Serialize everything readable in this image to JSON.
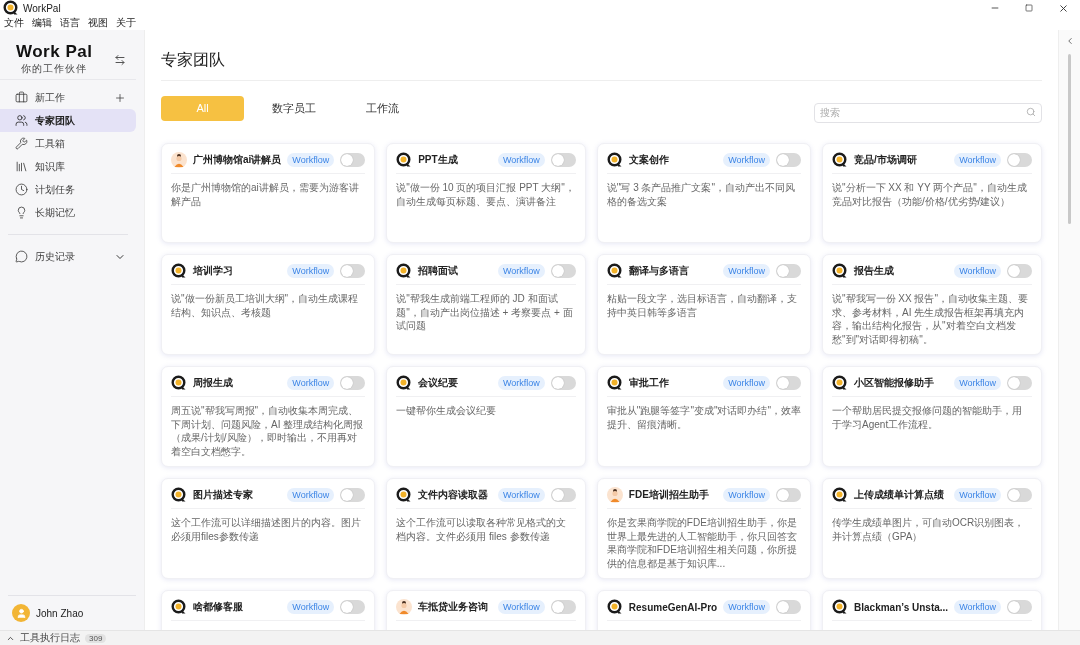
{
  "window": {
    "title": "WorkPal"
  },
  "menu": [
    "文件",
    "编辑",
    "语言",
    "视图",
    "关于"
  ],
  "sidebar": {
    "logo": "Work Pal",
    "tagline": "你的工作伙伴",
    "new_work": "新工作",
    "items": [
      {
        "label": "专家团队",
        "selected": true
      },
      {
        "label": "工具箱",
        "selected": false
      },
      {
        "label": "知识库",
        "selected": false
      },
      {
        "label": "计划任务",
        "selected": false
      },
      {
        "label": "长期记忆",
        "selected": false
      }
    ],
    "history": {
      "label": "历史记录",
      "expanded": false
    },
    "user": "John Zhao"
  },
  "page_title": "专家团队",
  "tabs": [
    {
      "label": "All",
      "selected": true
    },
    {
      "label": "数字员工",
      "selected": false
    },
    {
      "label": "工作流",
      "selected": false
    }
  ],
  "search": {
    "placeholder": "搜索"
  },
  "cards": [
    {
      "title": "广州博物馆ai讲解员",
      "kind": "avatar",
      "badge": "Workflow",
      "on": false,
      "description": "你是广州博物馆的ai讲解员，需要为游客讲解产品"
    },
    {
      "title": "PPT生成",
      "kind": "logo",
      "badge": "Workflow",
      "on": false,
      "description": "说\"做一份 10 页的项目汇报 PPT 大纲\"，自动生成每页标题、要点、演讲备注"
    },
    {
      "title": "文案创作",
      "kind": "logo",
      "badge": "Workflow",
      "on": false,
      "description": "说\"写 3 条产品推广文案\"，自动产出不同风格的备选文案"
    },
    {
      "title": "竞品/市场调研",
      "kind": "logo",
      "badge": "Workflow",
      "on": false,
      "description": "说\"分析一下 XX 和 YY 两个产品\"，自动生成竞品对比报告（功能/价格/优劣势/建议）"
    },
    {
      "title": "培训学习",
      "kind": "logo",
      "badge": "Workflow",
      "on": false,
      "description": "说\"做一份新员工培训大纲\"，自动生成课程结构、知识点、考核题"
    },
    {
      "title": "招聘面试",
      "kind": "logo",
      "badge": "Workflow",
      "on": false,
      "description": "说\"帮我生成前端工程师的 JD 和面试题\"，自动产出岗位描述 + 考察要点 + 面试问题"
    },
    {
      "title": "翻译与多语言",
      "kind": "logo",
      "badge": "Workflow",
      "on": false,
      "description": "粘贴一段文字，选目标语言，自动翻译，支持中英日韩等多语言"
    },
    {
      "title": "报告生成",
      "kind": "logo",
      "badge": "Workflow",
      "on": false,
      "description": "说\"帮我写一份 XX 报告\"，自动收集主题、要求、参考材料，AI 先生成报告框架再填充内容，输出结构化报告，从\"对着空白文档发愁\"到\"对话即得初稿\"。"
    },
    {
      "title": "周报生成",
      "kind": "logo",
      "badge": "Workflow",
      "on": false,
      "description": "周五说\"帮我写周报\"，自动收集本周完成、下周计划、问题风险，AI 整理成结构化周报（成果/计划/风险），即时输出，不用再对着空白文档憋字。"
    },
    {
      "title": "会议纪要",
      "kind": "logo",
      "badge": "Workflow",
      "on": false,
      "description": "一键帮你生成会议纪要"
    },
    {
      "title": "审批工作",
      "kind": "logo",
      "badge": "Workflow",
      "on": false,
      "description": "审批从\"跑腿等签字\"变成\"对话即办结\"，效率提升、留痕清晰。"
    },
    {
      "title": "小区智能报修助手",
      "kind": "logo",
      "badge": "Workflow",
      "on": false,
      "description": "一个帮助居民提交报修问题的智能助手，用于学习Agent工作流程。"
    },
    {
      "title": "图片描述专家",
      "kind": "logo",
      "badge": "Workflow",
      "on": false,
      "description": "这个工作流可以详细描述图片的内容。图片必须用files参数传递"
    },
    {
      "title": "文件内容读取器",
      "kind": "logo",
      "badge": "Workflow",
      "on": false,
      "description": "这个工作流可以读取各种常见格式的文档内容。文件必须用 files 参数传递"
    },
    {
      "title": "FDE培训招生助手",
      "kind": "avatar",
      "badge": "Workflow",
      "on": false,
      "description": "你是玄果商学院的FDE培训招生助手，你是世界上最先进的人工智能助手，你只回答玄果商学院和FDE培训招生相关问题，你所提供的信息都是基于知识库..."
    },
    {
      "title": "上传成绩单计算点绩",
      "kind": "logo",
      "badge": "Workflow",
      "on": false,
      "description": "传学生成绩单图片，可自动OCR识别图表，并计算点绩（GPA）"
    },
    {
      "title": "啥都修客服",
      "kind": "logo",
      "badge": "Workflow",
      "on": false
    },
    {
      "title": "车抵贷业务咨询",
      "kind": "avatar",
      "badge": "Workflow",
      "on": false
    },
    {
      "title": "ResumeGenAI-Pro",
      "kind": "logo",
      "badge": "Workflow",
      "on": false
    },
    {
      "title": "Blackman’s Unsta...",
      "kind": "logo",
      "badge": "Workflow",
      "on": false
    }
  ],
  "status_bar": {
    "label": "工具执行日志",
    "count": "309"
  }
}
